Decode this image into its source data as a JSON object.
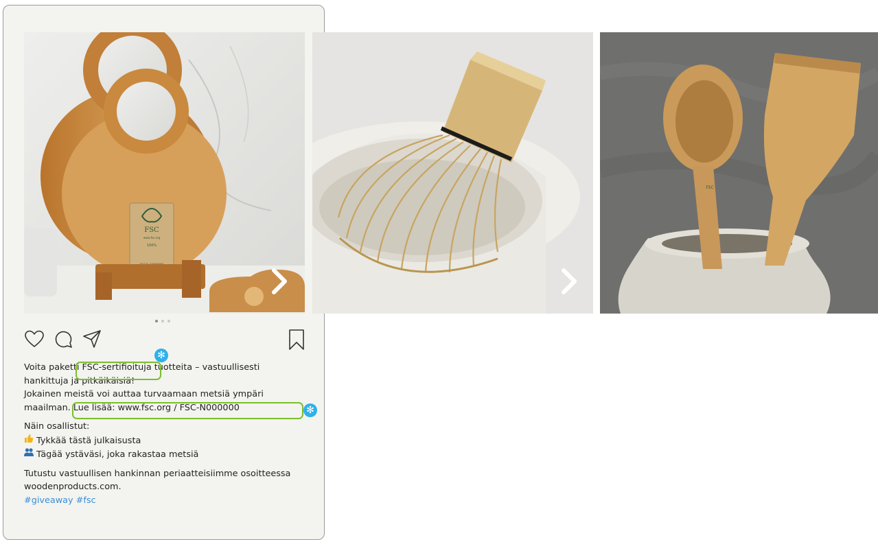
{
  "post": {
    "caption": {
      "line1_a": "Voita paketti ",
      "line1_highlight": "FSC-sertifioituja",
      "line1_b": " tuotteita – vastuullisesti",
      "line2": "hankittuja ja pitkäikäisiä!",
      "line3": "Jokainen meistä voi auttaa turvaamaan metsiä ympäri",
      "line4_a": "maailman. ",
      "line4_highlight": "Lue lisää: www.fsc.org / FSC-N000000",
      "how_title": "Näin osallistut:",
      "step1": "Tykkää tästä julkaisusta",
      "step2": "Tägää ystäväsi, joka rakastaa metsiä",
      "outro1": "Tutustu vastuullisen hankinnan periaatteisiimme osoitteessa",
      "outro2": "woodenproducts.com.",
      "hashtags": "#giveaway #fsc"
    },
    "badge_symbol": "✻",
    "carousel_dots": 3,
    "active_dot": 0,
    "icons": {
      "like": "heart-icon",
      "comment": "comment-icon",
      "share": "send-icon",
      "save": "bookmark-icon",
      "next": "chevron-right-icon",
      "step1": "thumbs-up-icon",
      "step2": "people-icon"
    },
    "fsc_label": {
      "brand": "FSC",
      "site": "www.fsc.org",
      "percent": "100%",
      "code": "FSC® C000000"
    }
  },
  "colors": {
    "highlight": "#7cbd2e",
    "badge": "#2fb1ea",
    "hashtag": "#3a8fd8",
    "card_bg": "#f3f3ef"
  }
}
